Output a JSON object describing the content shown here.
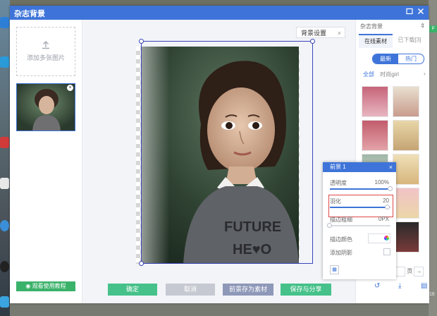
{
  "window": {
    "title": "杂志背景"
  },
  "left_panel": {
    "add_label": "添加多张图片",
    "tutorial_label": "观看使用教程",
    "tutorial_icon": "eye-icon"
  },
  "canvas": {
    "bg_setting_label": "背景设置",
    "bg_setting_close": "×"
  },
  "actions": {
    "confirm": "确定",
    "cancel": "取消",
    "save_foreground": "前景存为素材",
    "save_share": "保存与分享",
    "colors": {
      "confirm": "#46c18a",
      "cancel": "#c6c9d1",
      "save_foreground": "#8e98b8",
      "save_share": "#46c18a"
    }
  },
  "right_panel": {
    "dropdown": "杂志背景",
    "tabs": [
      "在线素材",
      "已下载[3]"
    ],
    "sort": [
      "最新",
      "热门"
    ],
    "categories": [
      "全部",
      "时尚girl"
    ],
    "page_unit": "页",
    "tool_icons": [
      "rotate-icon",
      "download-icon",
      "delete-icon"
    ]
  },
  "popup": {
    "title": "前景 1",
    "close": "×",
    "opacity_label": "透明度",
    "opacity_value": "100%",
    "opacity": 1.0,
    "feather_label": "羽化",
    "feather_value": "20",
    "feather": 0.95,
    "stroke_width_label": "描边粗细",
    "stroke_width_value": "0PX",
    "stroke_width": 0,
    "stroke_color_label": "描边颜色",
    "shadow_label": "添加阴影"
  },
  "desktop": {
    "right_tag": "P",
    "right_number": "16"
  },
  "colors": {
    "accent": "#3e74d9",
    "green": "#3bb26a",
    "selection": "#3b45b8"
  }
}
